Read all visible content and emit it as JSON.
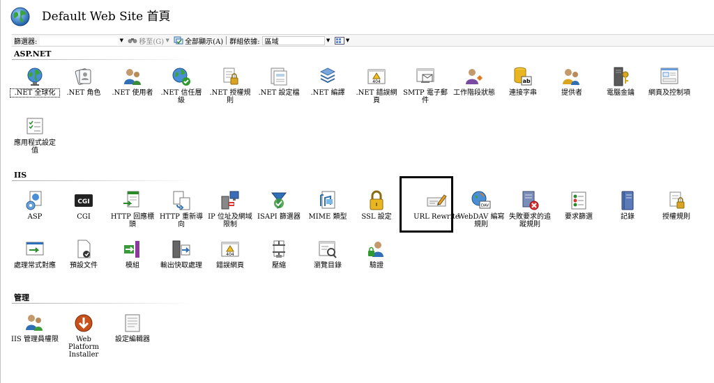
{
  "title": "Default Web Site 首頁",
  "toolbar": {
    "filter_label": "篩選器:",
    "filter_value": "",
    "goto_label": "移至(G)",
    "showall_label": "全部顯示(A)",
    "group_label": "群組依據:",
    "group_value": "區域"
  },
  "sections": {
    "aspnet": {
      "title": "ASP.NET",
      "items": [
        {
          "label": ".NET 全球化",
          "icon": "globe-icon"
        },
        {
          "label": ".NET 角色",
          "icon": "roles-icon"
        },
        {
          "label": ".NET 使用者",
          "icon": "users-icon"
        },
        {
          "label": ".NET 信任層級",
          "icon": "trust-globe-icon"
        },
        {
          "label": ".NET 授權規則",
          "icon": "authorization-rules-icon"
        },
        {
          "label": ".NET 設定檔",
          "icon": "profile-icon"
        },
        {
          "label": ".NET 編譯",
          "icon": "compilation-icon"
        },
        {
          "label": ".NET 錯誤網頁",
          "icon": "error-page-icon"
        },
        {
          "label": "SMTP 電子郵件",
          "icon": "smtp-email-icon"
        },
        {
          "label": "工作階段狀態",
          "icon": "session-state-icon"
        },
        {
          "label": "連接字串",
          "icon": "connection-string-icon"
        },
        {
          "label": "提供者",
          "icon": "providers-icon"
        },
        {
          "label": "電腦金鑰",
          "icon": "machine-key-icon"
        },
        {
          "label": "網頁及控制項",
          "icon": "pages-controls-icon"
        },
        {
          "label": "應用程式設定值",
          "icon": "app-settings-icon"
        }
      ]
    },
    "iis": {
      "title": "IIS",
      "items": [
        {
          "label": "ASP",
          "icon": "asp-icon"
        },
        {
          "label": "CGI",
          "icon": "cgi-icon"
        },
        {
          "label": "HTTP 回應標頭",
          "icon": "http-headers-icon"
        },
        {
          "label": "HTTP 重新導向",
          "icon": "http-redirect-icon"
        },
        {
          "label": "IP 位址及網域限制",
          "icon": "ip-restrictions-icon"
        },
        {
          "label": "ISAPI 篩選器",
          "icon": "isapi-filters-icon"
        },
        {
          "label": "MIME 類型",
          "icon": "mime-types-icon"
        },
        {
          "label": "SSL 設定",
          "icon": "ssl-lock-icon"
        },
        {
          "label": "URL Rewrite",
          "icon": "url-rewrite-icon"
        },
        {
          "label": "WebDAV 編寫規則",
          "icon": "webdav-icon"
        },
        {
          "label": "失敗要求的追蹤規則",
          "icon": "failed-request-tracing-icon"
        },
        {
          "label": "要求篩選",
          "icon": "request-filtering-icon"
        },
        {
          "label": "記錄",
          "icon": "logging-icon"
        },
        {
          "label": "授權規則",
          "icon": "authorization-icon"
        },
        {
          "label": "處理常式對應",
          "icon": "handler-mappings-icon"
        },
        {
          "label": "預設文件",
          "icon": "default-document-icon"
        },
        {
          "label": "模組",
          "icon": "modules-icon"
        },
        {
          "label": "輸出快取處理",
          "icon": "output-caching-icon"
        },
        {
          "label": "錯誤網頁",
          "icon": "error-pages-icon"
        },
        {
          "label": "壓縮",
          "icon": "compression-icon"
        },
        {
          "label": "瀏覽目錄",
          "icon": "directory-browsing-icon"
        },
        {
          "label": "驗證",
          "icon": "authentication-icon"
        }
      ]
    },
    "management": {
      "title": "管理",
      "items": [
        {
          "label": "IIS 管理員權限",
          "icon": "iis-manager-permissions-icon"
        },
        {
          "label": "Web Platform Installer",
          "icon": "web-platform-installer-icon"
        },
        {
          "label": "設定編輯器",
          "icon": "configuration-editor-icon"
        }
      ]
    }
  },
  "colors": {
    "accent_green": "#3a9a3a",
    "accent_blue": "#2e6fb8",
    "highlight_border": "#000000"
  }
}
